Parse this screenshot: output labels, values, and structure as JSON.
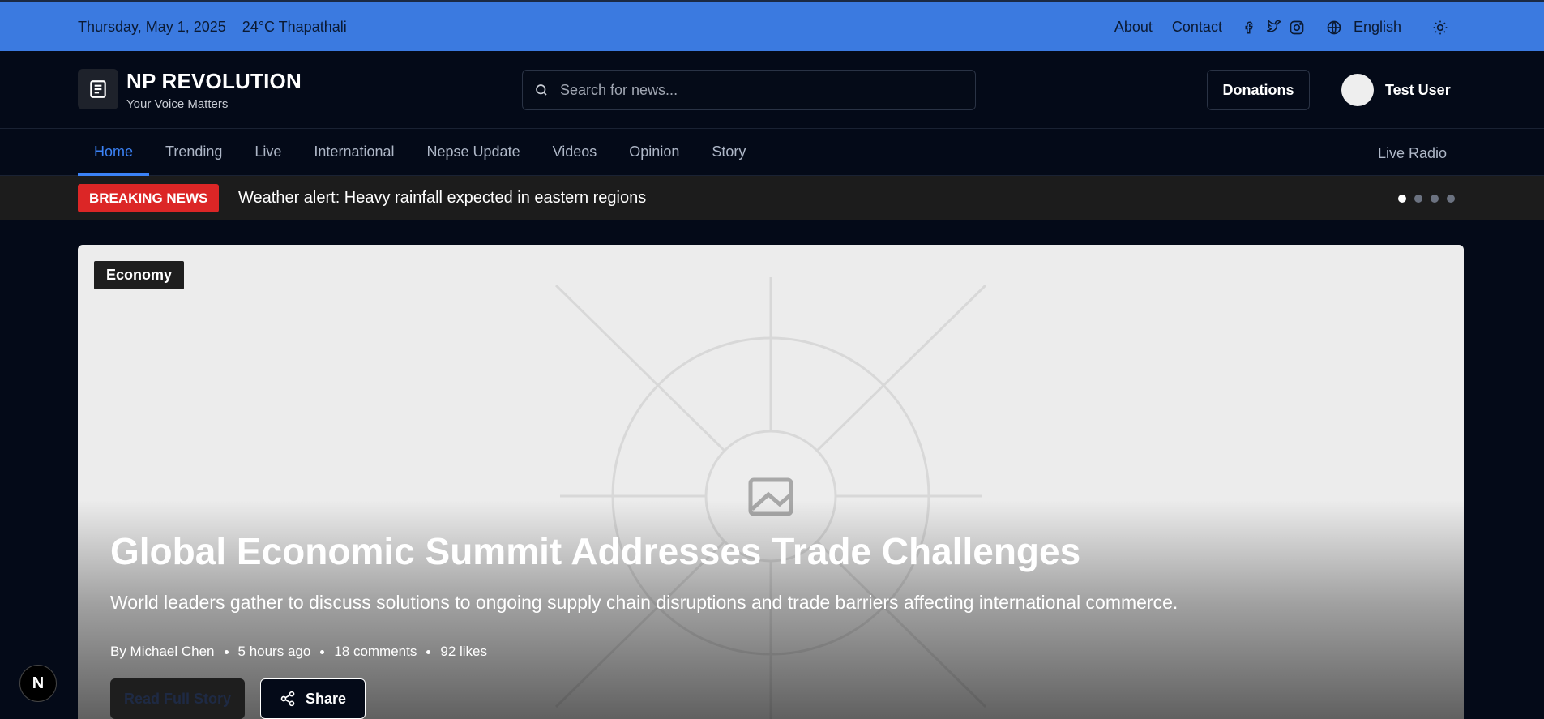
{
  "topbar": {
    "date": "Thursday, May 1, 2025",
    "weather": "24°C Thapathali",
    "about": "About",
    "contact": "Contact",
    "language": "English",
    "icons": [
      "facebook-icon",
      "twitter-icon",
      "instagram-icon",
      "globe-icon",
      "sun-icon"
    ]
  },
  "header": {
    "brand": "NP REVOLUTION",
    "tagline": "Your Voice Matters",
    "search_placeholder": "Search for news...",
    "donations": "Donations",
    "user_name": "Test User"
  },
  "nav": {
    "items": [
      {
        "label": "Home",
        "active": true
      },
      {
        "label": "Trending"
      },
      {
        "label": "Live"
      },
      {
        "label": "International"
      },
      {
        "label": "Nepse Update"
      },
      {
        "label": "Videos"
      },
      {
        "label": "Opinion"
      },
      {
        "label": "Story"
      }
    ],
    "live_radio": "Live Radio"
  },
  "breaking": {
    "badge": "BREAKING NEWS",
    "message": "Weather alert: Heavy rainfall expected in eastern regions",
    "dots_total": 4,
    "active_dot": 1
  },
  "hero": {
    "category": "Economy",
    "headline": "Global Economic Summit Addresses Trade Challenges",
    "summary": "World leaders gather to discuss solutions to ongoing supply chain disruptions and trade barriers affecting international commerce.",
    "author": "By Michael Chen",
    "time": "5 hours ago",
    "comments": "18 comments",
    "likes": "92 likes",
    "read_more": "Read Full Story",
    "share": "Share"
  },
  "fab": {
    "label": "N"
  },
  "colors": {
    "topbar": "#3b7ae0",
    "background": "#040a18",
    "accent": "#3b82f6",
    "breaking": "#dc2626"
  }
}
